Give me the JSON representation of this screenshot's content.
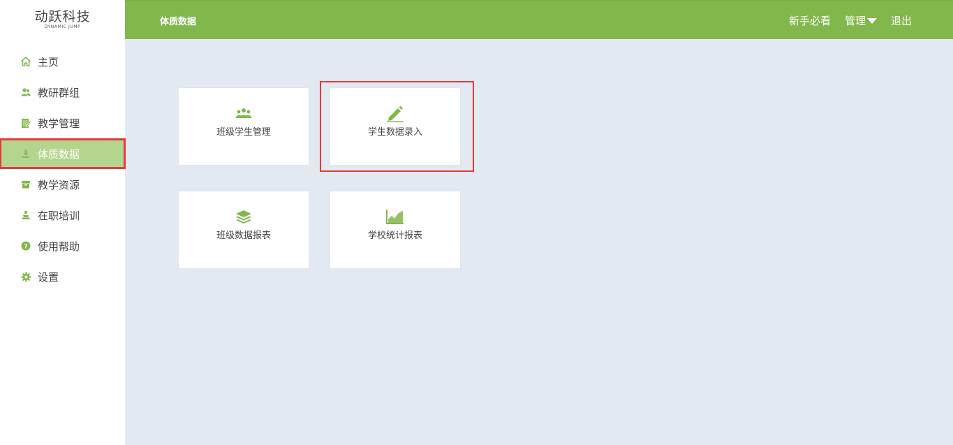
{
  "logo": {
    "main": "动跃科技",
    "sub": "DYNAMIC JUMP"
  },
  "header": {
    "title": "体质数据",
    "links": {
      "guide": "新手必看",
      "manage": "管理",
      "logout": "退出"
    }
  },
  "sidebar": {
    "items": [
      {
        "label": "主页",
        "icon": "home-icon"
      },
      {
        "label": "教研群组",
        "icon": "users-icon"
      },
      {
        "label": "教学管理",
        "icon": "edit-book-icon"
      },
      {
        "label": "体质数据",
        "icon": "download-icon",
        "active": true
      },
      {
        "label": "教学资源",
        "icon": "box-icon"
      },
      {
        "label": "在职培训",
        "icon": "trainer-icon"
      },
      {
        "label": "使用帮助",
        "icon": "help-icon"
      },
      {
        "label": "设置",
        "icon": "gear-icon"
      }
    ]
  },
  "cards": [
    {
      "label": "班级学生管理",
      "icon": "group-icon"
    },
    {
      "label": "学生数据录入",
      "icon": "pencil-icon",
      "highlighted": true
    },
    {
      "label": "班级数据报表",
      "icon": "layers-icon"
    },
    {
      "label": "学校统计报表",
      "icon": "area-chart-icon"
    }
  ],
  "colors": {
    "accent": "#82b74b",
    "active_item": "#b5d58f",
    "highlight": "#e23b3b",
    "background": "#e3e9f1"
  }
}
